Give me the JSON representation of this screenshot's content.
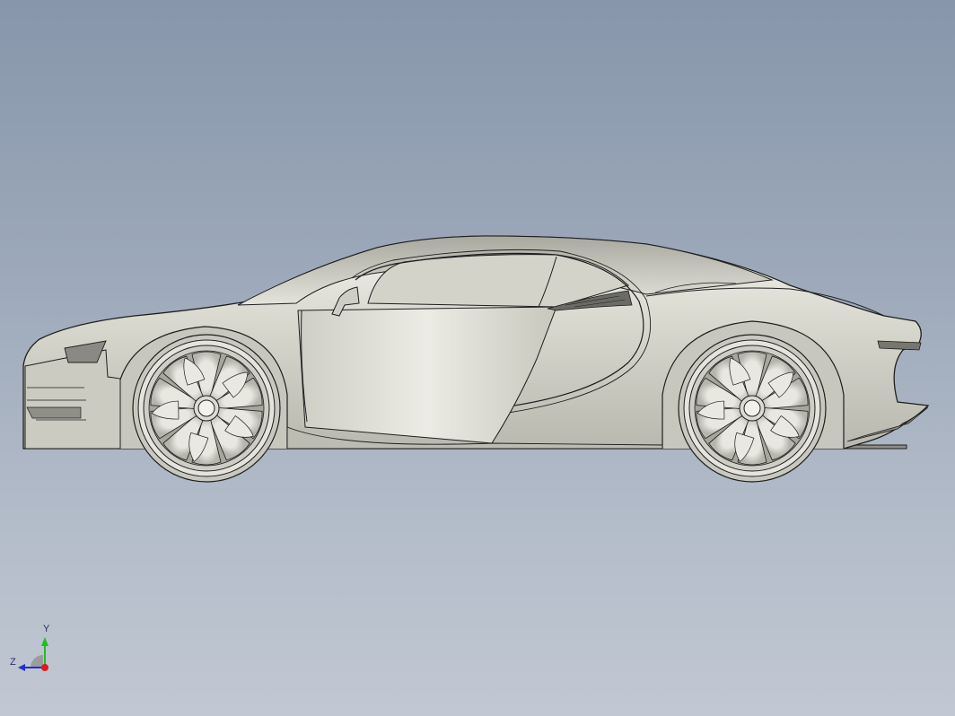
{
  "window": {
    "type": "cad-3d-viewport",
    "view": "side-orthographic"
  },
  "model": {
    "shading": "shaded-with-edges",
    "body_color": "#d6d5cc",
    "edge_color": "#1e1e1e"
  },
  "triad": {
    "y_label": "Y",
    "z_label": "Z",
    "y_color": "#1fbf1f",
    "z_color": "#2230c8",
    "x_color": "#e01818"
  },
  "colors": {
    "background_top": "#8796ab",
    "background_bottom": "#c1c8d3"
  }
}
